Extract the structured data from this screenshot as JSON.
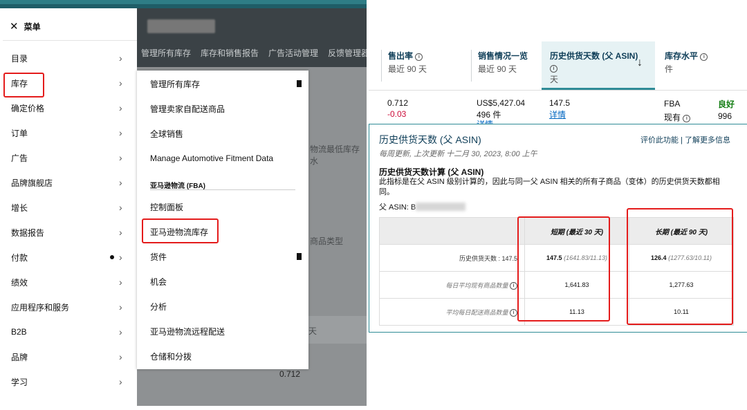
{
  "left_panel": {
    "header_nav": [
      "管理所有库存",
      "库存和销售报告",
      "广告活动管理",
      "反馈管理器"
    ],
    "background_fragments": {
      "price_text": "物流最低库存水",
      "type_text": "商品类型",
      "day_text": "天",
      "value_text": "0.712"
    },
    "menu": {
      "close_label": "菜单",
      "items": [
        {
          "label": "目录"
        },
        {
          "label": "库存"
        },
        {
          "label": "确定价格"
        },
        {
          "label": "订单"
        },
        {
          "label": "广告"
        },
        {
          "label": "品牌旗舰店"
        },
        {
          "label": "增长"
        },
        {
          "label": "数据报告"
        },
        {
          "label": "付款"
        },
        {
          "label": "绩效"
        },
        {
          "label": "应用程序和服务"
        },
        {
          "label": "B2B"
        },
        {
          "label": "品牌"
        },
        {
          "label": "学习"
        }
      ]
    },
    "submenu": {
      "items_top": [
        "管理所有库存",
        "管理卖家自配送商品",
        "全球销售",
        "Manage Automotive Fitment Data"
      ],
      "section_label": "亚马逊物流 (FBA)",
      "items_fba": [
        "控制面板",
        "亚马逊物流库存",
        "货件",
        "机会",
        "分析",
        "亚马逊物流远程配送",
        "仓储和分拨"
      ]
    }
  },
  "right_panel": {
    "tabs": [
      {
        "title": "售出率",
        "subtitle": "最近 90 天"
      },
      {
        "title": "销售情况一览",
        "subtitle": "最近 90 天"
      },
      {
        "title": "历史供货天数 (父 ASIN)",
        "subtitle": "天"
      },
      {
        "title": "库存水平",
        "subtitle": "件"
      }
    ],
    "sort_icon": "arrow-down",
    "row": {
      "sell_through": "0.712",
      "sell_through_change": "-0.03",
      "sales_amount": "US$5,427.04",
      "sales_units": "496 件",
      "sales_link": "详情",
      "days_supply": "147.5",
      "days_link": "详情",
      "fba_label": "FBA",
      "fba_status": "良好",
      "onhand_label": "现有",
      "onhand_value": "996"
    },
    "popup": {
      "title": "历史供货天数 (父 ASIN)",
      "updated": "每周更新, 上次更新 十二月 30, 2023, 8:00 上午",
      "rate_link": "评价此功能",
      "separator": "|",
      "learn_link": "了解更多信息",
      "calc_heading": "历史供货天数计算 (父 ASIN)",
      "description": "此指标是在父 ASIN 级别计算的，因此与同一父 ASIN 相关的所有子商品（变体）的历史供货天数都相同。",
      "parent_asin_label": "父 ASIN:",
      "parent_asin_value": "B",
      "table": {
        "col_short": "短期 (最近 30 天)",
        "col_long": "长期 (最近 90 天)",
        "rows": [
          {
            "label": "历史供货天数 : 147.5",
            "short_main": "147.5",
            "short_detail": "(1641.83/11.13)",
            "long_main": "126.4",
            "long_detail": "(1277.63/10.11)"
          },
          {
            "label": "每日平均现有商品数量",
            "short_main": "1,641.83",
            "long_main": "1,277.63"
          },
          {
            "label": "平均每日配送商品数量",
            "short_main": "11.13",
            "long_main": "10.11"
          }
        ]
      }
    }
  },
  "colors": {
    "accent_teal": "#2e8b96",
    "highlight_red": "#e41b1b",
    "link_blue": "#0066c0"
  }
}
